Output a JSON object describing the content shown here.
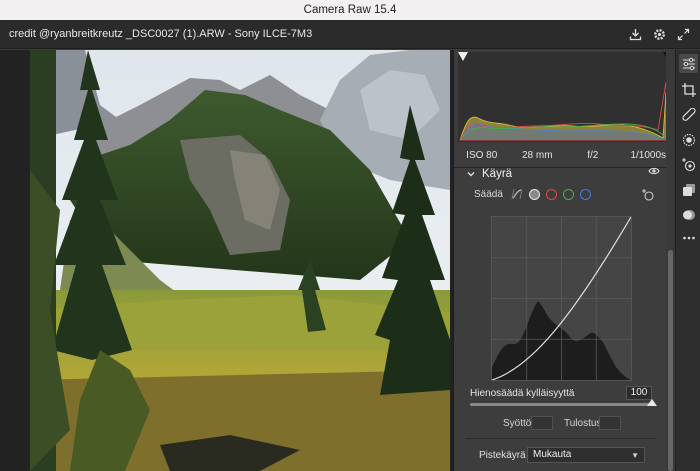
{
  "app": {
    "title": "Camera Raw 15.4"
  },
  "header": {
    "filename": "credit @ryanbreitkreutz _DSC0027 (1).ARW  -  Sony ILCE-7M3"
  },
  "exif": {
    "iso": "ISO 80",
    "focal": "28 mm",
    "aperture": "f/2",
    "shutter": "1/1000s"
  },
  "curve_section": {
    "title": "Käyrä",
    "adjust_label": "Säädä",
    "channels": [
      "white",
      "red",
      "green",
      "blue"
    ],
    "fine_tune_label": "Hienosäädä kylläisyyttä",
    "fine_tune_value": "100",
    "input_label": "Syöttö:",
    "output_label": "Tulostus:",
    "point_curve_label": "Pistekäyrä",
    "point_curve_value": "Mukauta"
  },
  "colors": {
    "accent": "#e8e8e8",
    "red": "#e04848",
    "green": "#46b046",
    "blue": "#3f7ee0"
  },
  "icons": [
    "save-icon",
    "gear-icon",
    "expand-icon",
    "sliders-icon",
    "crop-icon",
    "heal-icon",
    "mask-icon",
    "redeye-icon",
    "presets-icon",
    "snapshots-icon",
    "more-icon"
  ]
}
